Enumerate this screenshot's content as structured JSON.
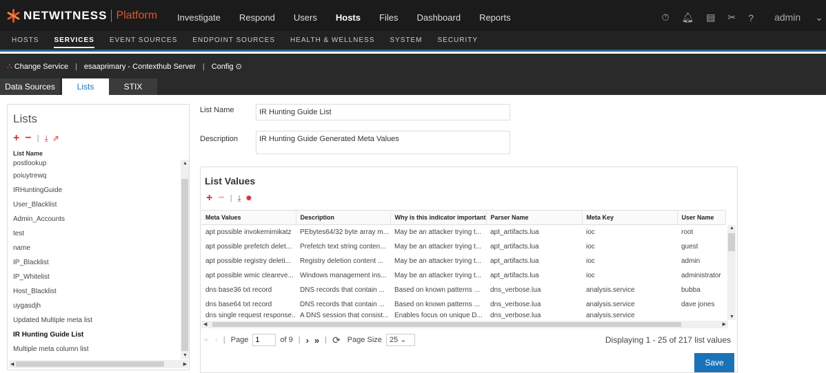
{
  "topbar": {
    "brand": "NETWITNESS",
    "platform": "Platform",
    "nav": [
      "Investigate",
      "Respond",
      "Users",
      "Hosts",
      "Files",
      "Dashboard",
      "Reports"
    ],
    "active_nav": "Hosts",
    "user": "admin"
  },
  "subnav": {
    "items": [
      "HOSTS",
      "SERVICES",
      "EVENT SOURCES",
      "ENDPOINT SOURCES",
      "HEALTH & WELLNESS",
      "SYSTEM",
      "SECURITY"
    ],
    "active": "SERVICES"
  },
  "servicebar": {
    "change_service": "Change Service",
    "service_name": "esaaprimary - Contexthub Server",
    "config": "Config"
  },
  "tabs": [
    "Data Sources",
    "Lists",
    "STIX"
  ],
  "active_tab": "Lists",
  "lists_panel": {
    "title": "Lists",
    "column_header": "List Name",
    "items": [
      "postlookup",
      "poiuytrewq",
      "IRHuntingGuide",
      "User_Blacklist",
      "Admin_Accounts",
      "test",
      "name",
      "IP_Blacklist",
      "IP_Whitelist",
      "Host_Blacklist",
      "uygasdjh",
      "Updated Multiple meta list",
      "IR Hunting Guide List",
      "Multiple meta column list"
    ],
    "selected": "IR Hunting Guide List"
  },
  "form": {
    "list_name_label": "List Name",
    "list_name_value": "IR Hunting Guide List",
    "description_label": "Description",
    "description_value": "IR Hunting Guide Generated Meta Values"
  },
  "list_values": {
    "title": "List Values",
    "columns": [
      "Meta Values",
      "Description",
      "Why is this indicator important?",
      "Parser Name",
      "Meta Key",
      "User Name"
    ],
    "rows": [
      [
        "apt possible invokemimikatz",
        "PEbytes64/32 byte array m...",
        "May be an attacker trying t...",
        "apt_artifacts.lua",
        "ioc",
        "root"
      ],
      [
        "apt possible prefetch delet...",
        "Prefetch text string conten...",
        "May be an attacker trying t...",
        "apt_artifacts.lua",
        "ioc",
        "guest"
      ],
      [
        "apt possible registry deleti...",
        "Registry deletion content ...",
        "May be an attacker trying t...",
        "apt_artifacts.lua",
        "ioc",
        "admin"
      ],
      [
        "apt possible wmic clearеve...",
        "Windows management ins...",
        "May be an attacker trying t...",
        "apt_artifacts.lua",
        "ioc",
        "administrator"
      ],
      [
        "dns base36 txt record",
        "DNS records that contain ...",
        "Based on known patterns ...",
        "dns_verbose.lua",
        "analysis.service",
        "bubba"
      ],
      [
        "dns base64 txt record",
        "DNS records that contain ...",
        "Based on known patterns ...",
        "dns_verbose.lua",
        "analysis.service",
        "dave jones"
      ],
      [
        "dns single request response...",
        "A DNS session that consist...",
        "Enables focus on unique D...",
        "dns_verbose.lua",
        "analysis.service",
        ""
      ]
    ]
  },
  "pager": {
    "page_label": "Page",
    "page_value": "1",
    "of_label": "of 9",
    "page_size_label": "Page Size",
    "page_size_value": "25",
    "display_text": "Displaying 1 - 25 of 217 list values"
  },
  "save_label": "Save"
}
